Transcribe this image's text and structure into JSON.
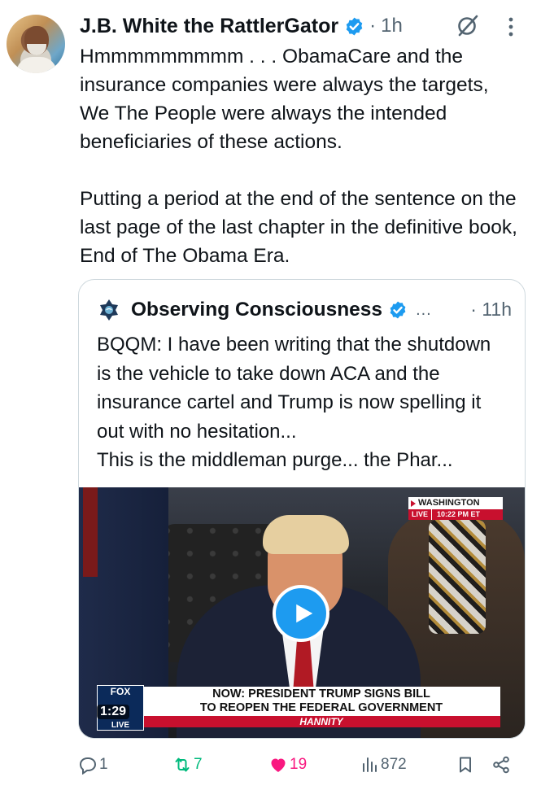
{
  "post": {
    "author_name": "J.B. White the RattlerGator",
    "separator": "·",
    "time": "1h",
    "text": "Hmmmmmmmmm . . . ObamaCare and the insurance companies were always the targets, We The People were always the intended beneficiaries of these actions.\n\nPutting a period at the end of the sentence on the last page of the last chapter in the definitive book, End of The Obama Era."
  },
  "quote": {
    "author_name": "Observing Consciousness",
    "ellipsis": "...",
    "separator": "·",
    "time": "11h",
    "text": "BQQM: I have been writing that the shutdown is the vehicle to take down ACA and the insurance cartel and Trump is now spelling it out with no hesitation...\n   This is the middleman purge... the Phar..."
  },
  "video": {
    "location_label": "WASHINGTON",
    "live_label": "LIVE",
    "clock": "10:22 PM ET",
    "headline": "NOW: PRESIDENT TRUMP SIGNS BILL\nTO REOPEN THE FEDERAL GOVERNMENT",
    "show_name": "HANNITY",
    "network_logo": "FOX",
    "network_live": "LIVE",
    "duration": "1:29",
    "play_icon": "play-icon"
  },
  "actions": {
    "replies": "1",
    "reposts": "7",
    "likes": "19",
    "views": "872"
  },
  "colors": {
    "accent": "#1d9bf0",
    "repost": "#00ba7c",
    "like": "#f91880",
    "muted": "#536471",
    "border": "#cfd9de"
  }
}
